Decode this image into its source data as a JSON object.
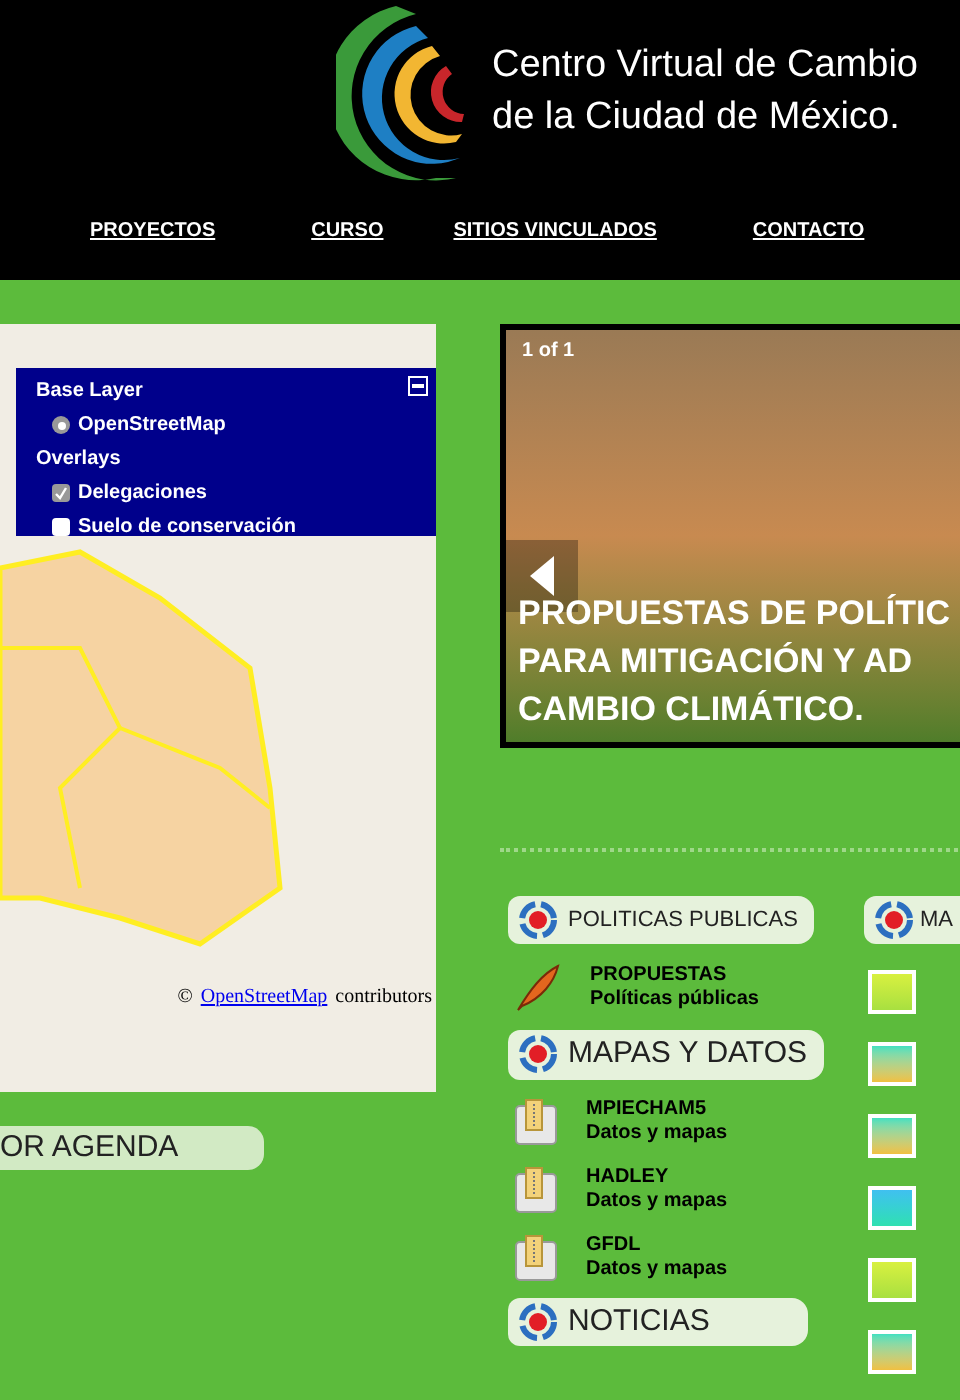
{
  "header": {
    "title_lines": [
      "Centro Virtual de Cambio",
      "de la Ciudad de México."
    ]
  },
  "nav": [
    {
      "label": "PROYECTOS"
    },
    {
      "label": "CURSO"
    },
    {
      "label": "SITIOS VINCULADOS"
    },
    {
      "label": "CONTACTO"
    }
  ],
  "map": {
    "layer_switcher": {
      "base_heading": "Base Layer",
      "base_layers": [
        {
          "label": "OpenStreetMap",
          "selected": true
        }
      ],
      "overlays_heading": "Overlays",
      "overlays": [
        {
          "label": "Delegaciones",
          "checked": true
        },
        {
          "label": "Suelo de conservación",
          "checked": false
        }
      ]
    },
    "attribution_prefix": "©",
    "attribution_link": "OpenStreetMap",
    "attribution_suffix": "contributors"
  },
  "agenda_heading": "OR AGENDA",
  "slideshow": {
    "counter": "1 of 1",
    "caption_lines": [
      "PROPUESTAS DE POLÍTIC",
      "PARA MITIGACIÓN Y AD",
      "CAMBIO CLIMÁTICO."
    ]
  },
  "sections": [
    {
      "heading": "POLITICAS PUBLICAS",
      "items": [
        {
          "kind": "quill",
          "title": "PROPUESTAS",
          "subtitle": "Políticas públicas"
        }
      ]
    },
    {
      "heading": "MAPAS Y DATOS",
      "items": [
        {
          "kind": "archive",
          "title": "MPIECHAM5",
          "subtitle": "Datos y mapas"
        },
        {
          "kind": "archive",
          "title": "HADLEY",
          "subtitle": "Datos y mapas"
        },
        {
          "kind": "archive",
          "title": "GFDL",
          "subtitle": "Datos y mapas"
        }
      ]
    },
    {
      "heading": "NOTICIAS"
    }
  ],
  "side_section": {
    "heading": "MA",
    "thumbnails": [
      {
        "kind": "yellow"
      },
      {
        "kind": "teal"
      },
      {
        "kind": "teal"
      },
      {
        "kind": "blue"
      },
      {
        "kind": "yellow"
      },
      {
        "kind": "teal"
      }
    ]
  }
}
